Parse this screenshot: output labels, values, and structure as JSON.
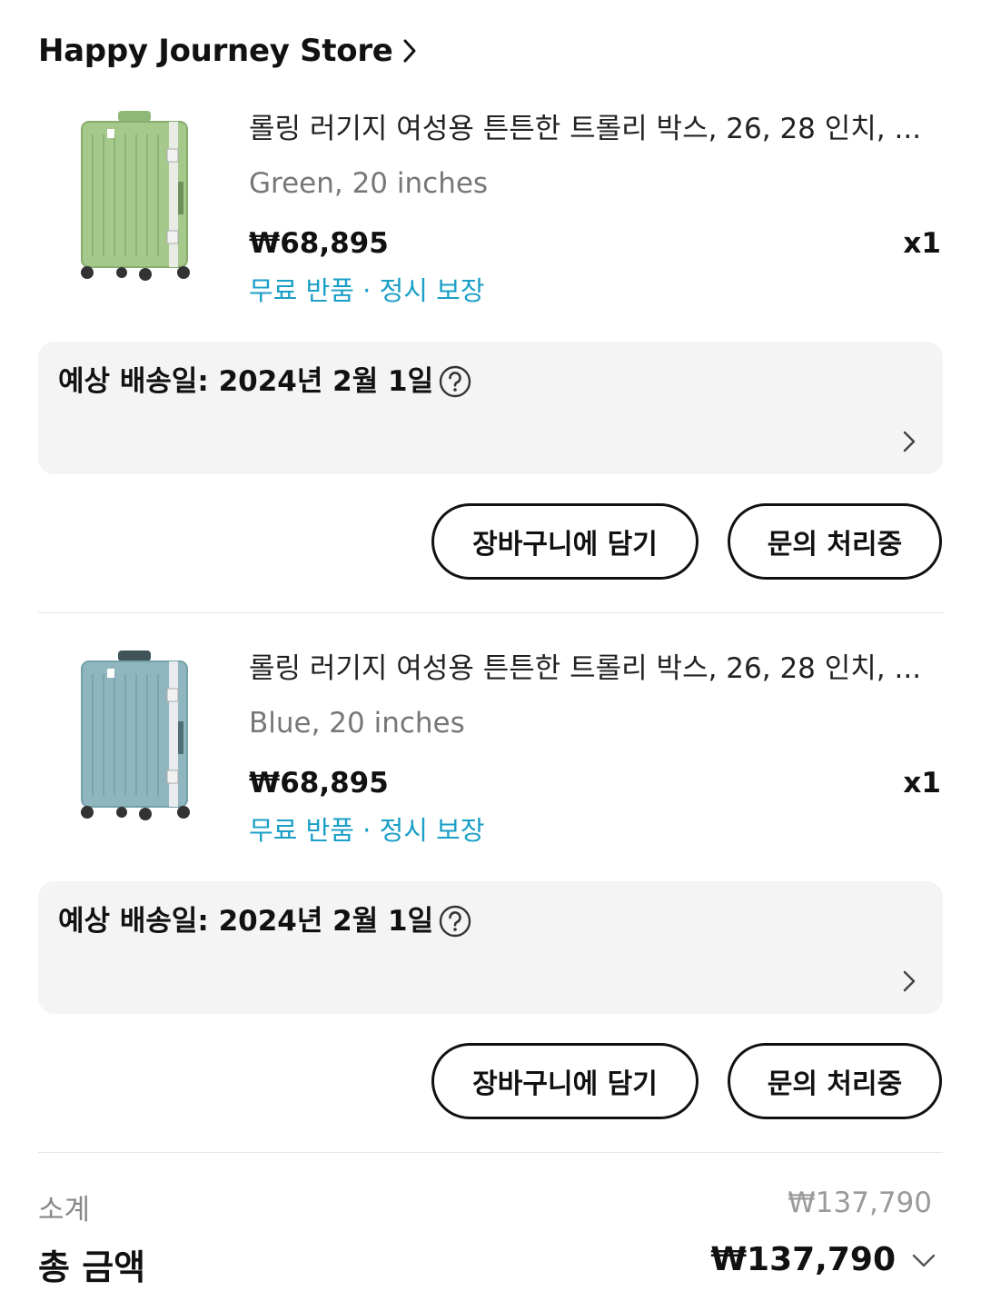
{
  "store": {
    "name": "Happy Journey Store"
  },
  "items": [
    {
      "title": "롤링 러기지 여성용 튼튼한 트롤리 박스, 26, 28 인치, ...",
      "variant": "Green, 20 inches",
      "price": "₩68,895",
      "quantity": "x1",
      "benefits": "무료 반품 · 정시 보장",
      "color": "#a4c98a",
      "delivery": "예상 배송일: 2024년 2월 1일",
      "cart_button": "장바구니에 담기",
      "inquiry_button": "문의 처리중"
    },
    {
      "title": "롤링 러기지 여성용 튼튼한 트롤리 박스, 26, 28 인치, ...",
      "variant": "Blue, 20 inches",
      "price": "₩68,895",
      "quantity": "x1",
      "benefits": "무료 반품 · 정시 보장",
      "color": "#8fb6bf",
      "delivery": "예상 배송일: 2024년 2월 1일",
      "cart_button": "장바구니에 담기",
      "inquiry_button": "문의 처리중"
    }
  ],
  "summary": {
    "subtotal_label": "소계",
    "subtotal_value": "₩137,790",
    "total_label": "총 금액",
    "total_value": "₩137,790"
  },
  "colors": {
    "accent": "#1a9fc7",
    "text": "#111111",
    "muted": "#777777",
    "panel": "#f4f4f4"
  }
}
